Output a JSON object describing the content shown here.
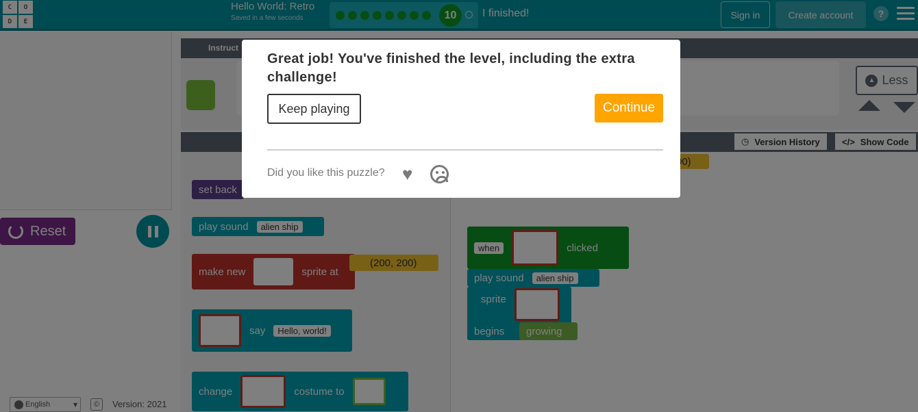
{
  "header": {
    "logo_letters": [
      "C",
      "O",
      "D",
      "E"
    ],
    "title": "Hello World: Retro",
    "subtitle": "Saved in a few seconds",
    "progress_current": "10",
    "completed_dots": 9,
    "finished_label": "I finished!",
    "sign_in": "Sign in",
    "create_account": "Create account",
    "help": "?"
  },
  "left_panel": {
    "reset_label": "Reset",
    "language": "English",
    "version": "Version: 2021"
  },
  "instructions": {
    "tab_label": "Instruct",
    "less_label": "Less"
  },
  "workspace": {
    "version_history": "Version History",
    "show_code": "Show Code"
  },
  "toolbox_blocks": {
    "set_background": "set back",
    "play_sound": "play sound",
    "sound_value": "alien ship",
    "make_new": "make new",
    "sprite_at": "sprite at",
    "coords": "(200, 200)",
    "say": "say",
    "say_value": "Hello, world!",
    "change": "change",
    "costume_to": "costume to"
  },
  "workspace_blocks": {
    "when": "when",
    "clicked": "clicked",
    "play_sound": "play sound",
    "sound_value": "alien ship",
    "sprite": "sprite",
    "begins": "begins",
    "growing": "growing",
    "coord_fragment": "00)"
  },
  "modal": {
    "title": "Great job! You've finished the level, including the extra challenge!",
    "keep_playing": "Keep playing",
    "continue": "Continue",
    "feedback_question": "Did you like this puzzle?",
    "like_icon": "heart-icon",
    "dislike_icon": "sad-face-icon"
  },
  "colors": {
    "header": "#0094a3",
    "continue": "#ffa400",
    "progress": "#0e9b27"
  }
}
